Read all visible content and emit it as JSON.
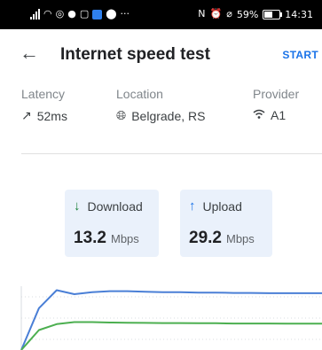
{
  "status_bar": {
    "left_icons": [
      "signal-icon",
      "wifi-icon",
      "app-icon",
      "app-icon",
      "instagram-icon",
      "calendar-icon",
      "facebook-icon",
      "more-notifications-icon"
    ],
    "more": "···",
    "battery": "59%",
    "time": "14:31"
  },
  "app_bar": {
    "back_icon": "arrow-left-icon",
    "title": "Internet speed test",
    "action": "START"
  },
  "info": {
    "latency": {
      "label": "Latency",
      "value": "52ms",
      "icon": "trending-up-icon"
    },
    "location": {
      "label": "Location",
      "value": "Belgrade, RS",
      "icon": "globe-icon"
    },
    "provider": {
      "label": "Provider",
      "value": "A1",
      "icon": "wifi-icon"
    }
  },
  "download": {
    "label": "Download",
    "value": "13.2",
    "unit": "Mbps",
    "color": "#188038"
  },
  "upload": {
    "label": "Upload",
    "value": "29.2",
    "unit": "Mbps",
    "color": "#1a73e8"
  },
  "chart_data": {
    "type": "line",
    "series": [
      {
        "color": "#4a7fd6",
        "values": [
          0,
          21,
          30,
          28,
          29,
          29.5,
          29.5,
          29.2,
          29,
          29,
          28.8,
          28.8,
          28.6,
          28.6,
          28.5,
          28.5,
          28.5,
          28.5
        ]
      },
      {
        "color": "#4caf50",
        "values": [
          0,
          10,
          13,
          14,
          14,
          13.8,
          13.7,
          13.6,
          13.5,
          13.5,
          13.4,
          13.4,
          13.3,
          13.3,
          13.3,
          13.2,
          13.2,
          13.2
        ]
      }
    ],
    "grid": true
  }
}
